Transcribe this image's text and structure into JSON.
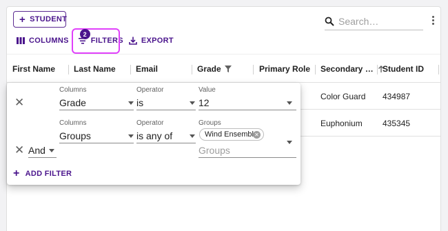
{
  "toolbar": {
    "student_label": "STUDENT",
    "search_placeholder": "Search…",
    "columns_label": "COLUMNS",
    "filters_label": "FILTERS",
    "filters_count": "2",
    "export_label": "EXPORT"
  },
  "columns": [
    "First Name",
    "Last Name",
    "Email",
    "Grade",
    "Primary Role",
    "Secondary …",
    "Student ID"
  ],
  "rows": [
    {
      "secondary_role": "Color Guard",
      "student_id": "434987"
    },
    {
      "secondary_role": "Euphonium",
      "student_id": "435345"
    }
  ],
  "filter_panel": {
    "filters": [
      {
        "columns_label": "Columns",
        "column": "Grade",
        "operator_label": "Operator",
        "operator": "is",
        "value_label": "Value",
        "value": "12"
      },
      {
        "logic": "And",
        "columns_label": "Columns",
        "column": "Groups",
        "operator_label": "Operator",
        "operator": "is any of",
        "value_label": "Groups",
        "chip": "Wind Ensemble",
        "value_placeholder": "Groups"
      }
    ],
    "add_filter_label": "ADD FILTER"
  },
  "colors": {
    "accent": "#4a148c",
    "highlight": "#e040fb"
  }
}
